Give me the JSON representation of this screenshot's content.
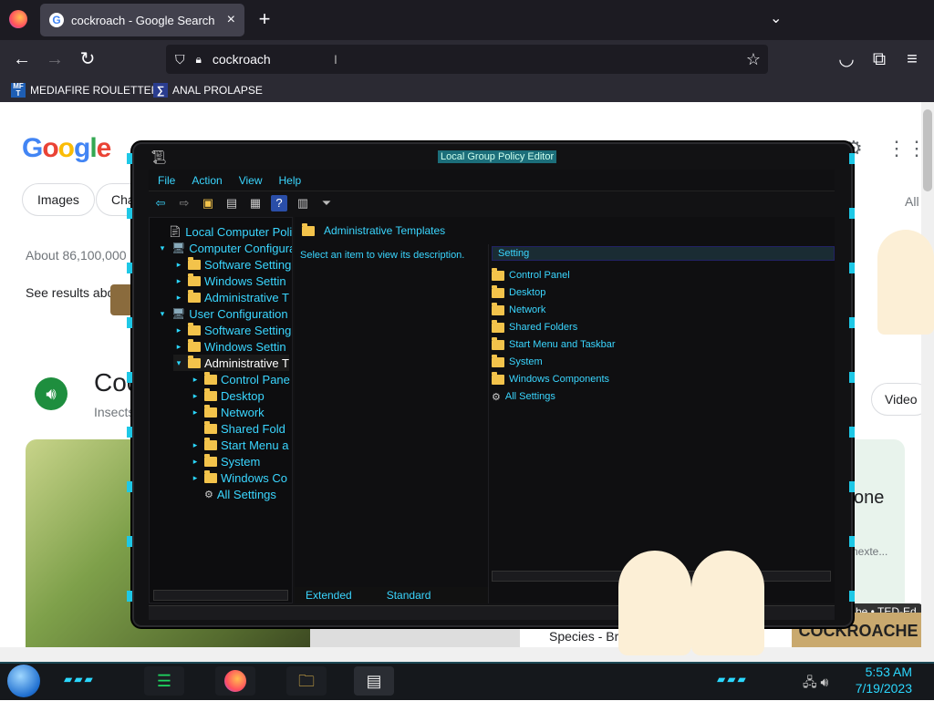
{
  "browser": {
    "tab_title": "cockroach - Google Search",
    "tab_close": "×",
    "new_tab": "+",
    "url": "cockroach",
    "bookmarks": [
      {
        "icon": "MF T",
        "label": "MEDIAFIRE ROULETTER"
      },
      {
        "icon": "∑",
        "label": "ANAL PROLAPSE"
      }
    ]
  },
  "google": {
    "logo": "Google",
    "chips": [
      "Images",
      "Cha"
    ],
    "all_label": "All",
    "about": "About 86,100,000",
    "see_results": "See results about",
    "heading": "Coc",
    "subheading": "Insects",
    "species_caption": "Species - Brita",
    "right_card_text": "one",
    "right_card_sub": "rnexte...",
    "video_chip": "Video",
    "ted_label": "be • TED-Ed",
    "cock_banner": "COCKROACHE"
  },
  "gpedit": {
    "title": "Local Group Policy Editor",
    "menu": [
      "File",
      "Action",
      "View",
      "Help"
    ],
    "tree": [
      {
        "label": "Local Computer Policy",
        "level": 0,
        "arrow": ""
      },
      {
        "label": "Computer Configura",
        "level": 1,
        "arrow": "▾"
      },
      {
        "label": "Software Setting",
        "level": 2,
        "arrow": "▸"
      },
      {
        "label": "Windows Settin",
        "level": 2,
        "arrow": "▸"
      },
      {
        "label": "Administrative T",
        "level": 2,
        "arrow": "▸"
      },
      {
        "label": "User Configuration",
        "level": 1,
        "arrow": "▾"
      },
      {
        "label": "Software Setting",
        "level": 2,
        "arrow": "▸"
      },
      {
        "label": "Windows Settin",
        "level": 2,
        "arrow": "▸"
      },
      {
        "label": "Administrative T",
        "level": 2,
        "arrow": "▾",
        "selected": true
      },
      {
        "label": "Control Pane",
        "level": 3,
        "arrow": "▸"
      },
      {
        "label": "Desktop",
        "level": 3,
        "arrow": "▸"
      },
      {
        "label": "Network",
        "level": 3,
        "arrow": "▸"
      },
      {
        "label": "Shared Fold",
        "level": 3,
        "arrow": ""
      },
      {
        "label": "Start Menu a",
        "level": 3,
        "arrow": "▸"
      },
      {
        "label": "System",
        "level": 3,
        "arrow": "▸"
      },
      {
        "label": "Windows Co",
        "level": 3,
        "arrow": "▸"
      },
      {
        "label": "All Settings",
        "level": 3,
        "arrow": ""
      }
    ],
    "right_header": "Administrative Templates",
    "description": "Select an item to view its description.",
    "list_header": "Setting",
    "items": [
      "Control Panel",
      "Desktop",
      "Network",
      "Shared Folders",
      "Start Menu and Taskbar",
      "System",
      "Windows Components",
      "All Settings"
    ],
    "tabs": [
      "Extended",
      "Standard"
    ]
  },
  "taskbar": {
    "time": "5:53 AM",
    "date": "7/19/2023"
  },
  "colors": {
    "accent": "#3ad6ff",
    "firefox_dark": "#1c1b22",
    "google_green": "#1e8e3e"
  }
}
